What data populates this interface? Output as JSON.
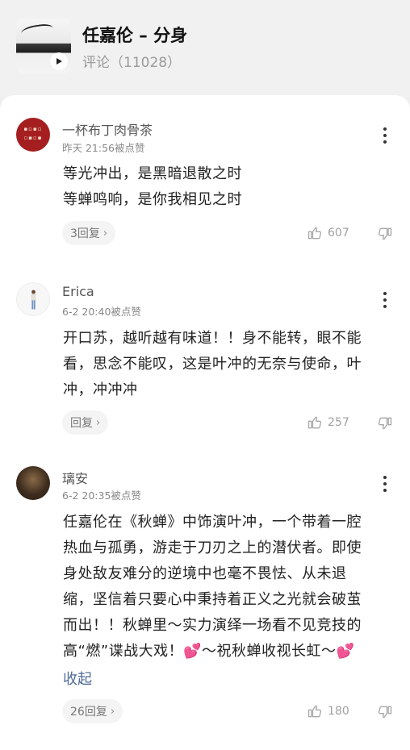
{
  "header": {
    "song_title": "任嘉伦 – 分身",
    "comment_count": "评论（11028）"
  },
  "comments": [
    {
      "username": "一杯布丁肉骨茶",
      "meta": "昨天 21:56被点赞",
      "lines": [
        "等光冲出，是黑暗退散之时",
        "等蝉鸣响，是你我相见之时"
      ],
      "reply_label": "3回复",
      "likes": "607"
    },
    {
      "username": "Erica",
      "meta": "6-2 20:40被点赞",
      "lines": [
        "开口苏，越听越有味道！！身不能转，眼不能",
        "看，思念不能叹，这是叶冲的无奈与使命，叶",
        "冲，冲冲冲"
      ],
      "reply_label": "回复",
      "likes": "257"
    },
    {
      "username": "璃安",
      "meta": "6-2 20:35被点赞",
      "lines": [
        "任嘉伦在《秋蝉》中饰演叶冲，一个带着一腔",
        "热血与孤勇，游走于刀刃之上的潜伏者。即使",
        "身处敌友难分的逆境中也毫不畏怯、从未退",
        "缩，坚信着只要心中秉持着正义之光就会破茧",
        "而出！！秋蝉里～实力演绎一场看不见竞技的",
        "高“燃”谍战大戏！💕～祝秋蝉收视长虹～💕"
      ],
      "collapse_label": "收起",
      "reply_label": "26回复",
      "likes": "180"
    }
  ],
  "icons": [
    "play-icon",
    "more-icon",
    "thumbs-up-icon",
    "thumbs-down-icon",
    "chevron-right-icon"
  ]
}
